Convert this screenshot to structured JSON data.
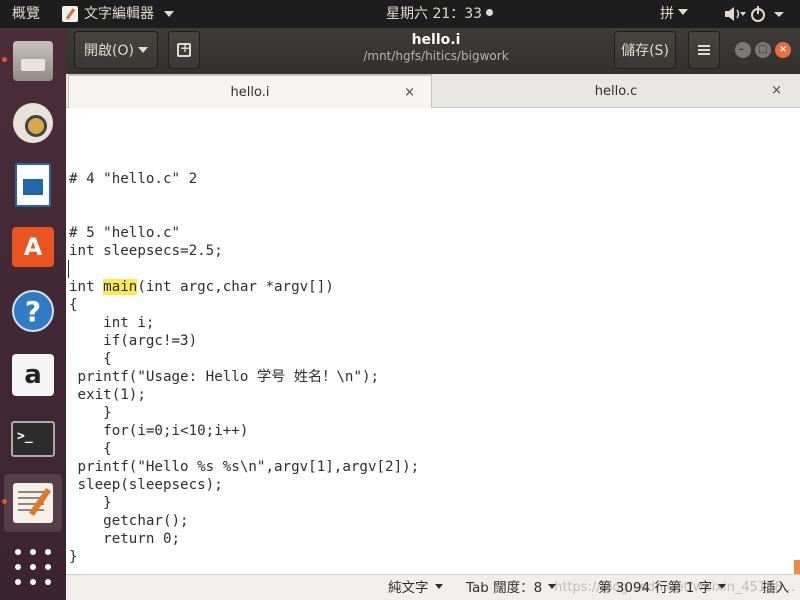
{
  "top_panel": {
    "activities": "概覽",
    "app_menu": "文字編輯器",
    "clock": "星期六 21：33",
    "input_method": "拼"
  },
  "launcher": {
    "items": [
      {
        "name": "files"
      },
      {
        "name": "rhythmbox"
      },
      {
        "name": "libreoffice-writer"
      },
      {
        "name": "ubuntu-software",
        "glyph": "A"
      },
      {
        "name": "help",
        "glyph": "?"
      },
      {
        "name": "amazon",
        "glyph": "a"
      },
      {
        "name": "terminal",
        "glyph": ">_"
      },
      {
        "name": "text-editor"
      },
      {
        "name": "show-applications"
      }
    ]
  },
  "headerbar": {
    "open_label": "開啟(O)",
    "title": "hello.i",
    "subtitle": "/mnt/hgfs/hitics/bigwork",
    "save_label": "儲存(S)"
  },
  "tabs": [
    {
      "label": "hello.i",
      "close": "×",
      "active": true
    },
    {
      "label": "hello.c",
      "close": "×",
      "active": false
    }
  ],
  "code": {
    "lines": [
      "",
      "",
      "",
      "# 4 \"hello.c\" 2",
      "",
      "",
      "# 5 \"hello.c\"",
      "int sleepsecs=2.5;",
      "",
      "int main(int argc,char *argv[])",
      "{",
      "    int i;",
      "    if(argc!=3)",
      "    {",
      " printf(\"Usage: Hello 学号 姓名！\\n\");",
      " exit(1);",
      "    }",
      "    for(i=0;i<10;i++)",
      "    {",
      " printf(\"Hello %s %s\\n\",argv[1],argv[2]);",
      " sleep(sleepsecs);",
      "    }",
      "    getchar();",
      "    return 0;",
      "}"
    ],
    "highlight_word": "main",
    "highlight_color": "#fce94f"
  },
  "statusbar": {
    "language": "純文字",
    "tab_width": "Tab 闊度：8",
    "position": "第 3094 行第 1 字",
    "mode": "插入",
    "watermark": "https://blog.csdn.net/weixin_45158..."
  },
  "colors": {
    "accent": "#e95420",
    "panel": "#1d1d1d",
    "launcher": "#4a2d39"
  }
}
